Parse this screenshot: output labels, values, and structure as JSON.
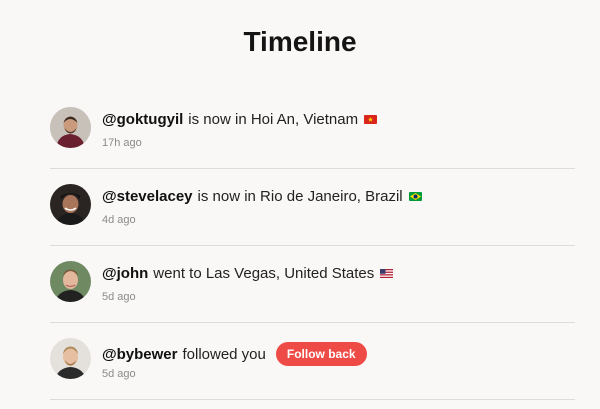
{
  "page": {
    "title": "Timeline"
  },
  "timeline": [
    {
      "handle": "@goktugyil",
      "action": "is now in Hoi An, Vietnam",
      "flag": "vietnam-flag-icon",
      "time": "17h ago",
      "avatar": "avatar-goktugyil"
    },
    {
      "handle": "@stevelacey",
      "action": "is now in Rio de Janeiro, Brazil",
      "flag": "brazil-flag-icon",
      "time": "4d ago",
      "avatar": "avatar-stevelacey"
    },
    {
      "handle": "@john",
      "action": "went to Las Vegas, United States",
      "flag": "usa-flag-icon",
      "time": "5d ago",
      "avatar": "avatar-john"
    },
    {
      "handle": "@bybewer",
      "action": "followed you",
      "time": "5d ago",
      "avatar": "avatar-bybewer",
      "button_label": "Follow back"
    }
  ],
  "colors": {
    "accent": "#ee4a46",
    "background": "#f9f8f7",
    "divider": "#dedcda"
  }
}
